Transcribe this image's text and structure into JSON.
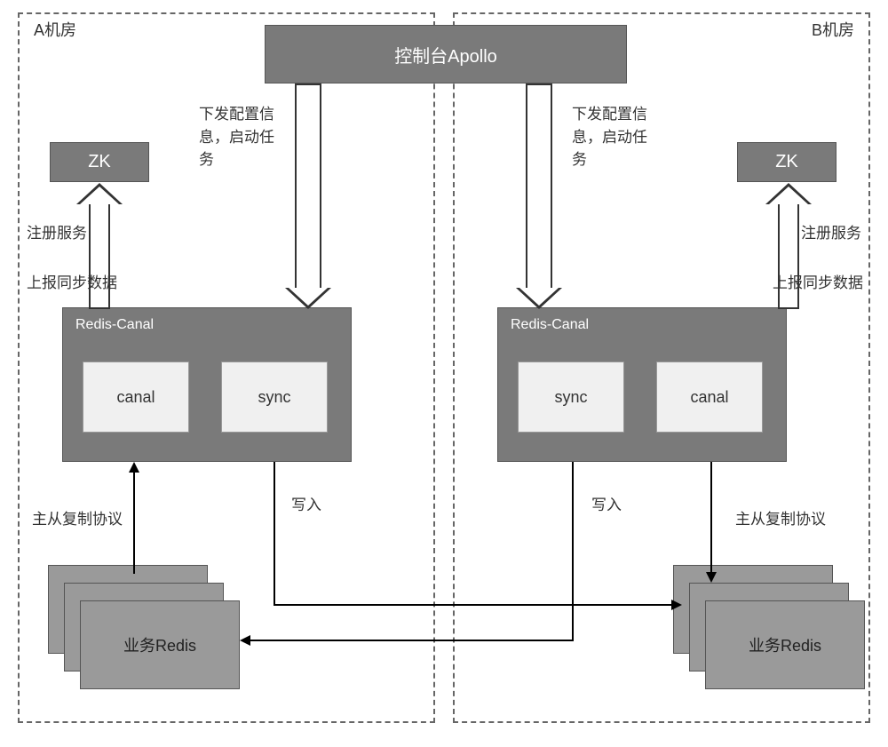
{
  "rooms": {
    "a_label": "A机房",
    "b_label": "B机房"
  },
  "apollo": {
    "title": "控制台Apollo"
  },
  "zk": {
    "label": "ZK"
  },
  "redis_canal": {
    "title": "Redis-Canal",
    "canal_label": "canal",
    "sync_label": "sync"
  },
  "biz_redis": {
    "label": "业务Redis"
  },
  "labels": {
    "dispatch_config": "下发配置信息，启动任务",
    "register_service": "注册服务",
    "report_sync": "上报同步数据",
    "master_slave": "主从复制协议",
    "write": "写入"
  }
}
